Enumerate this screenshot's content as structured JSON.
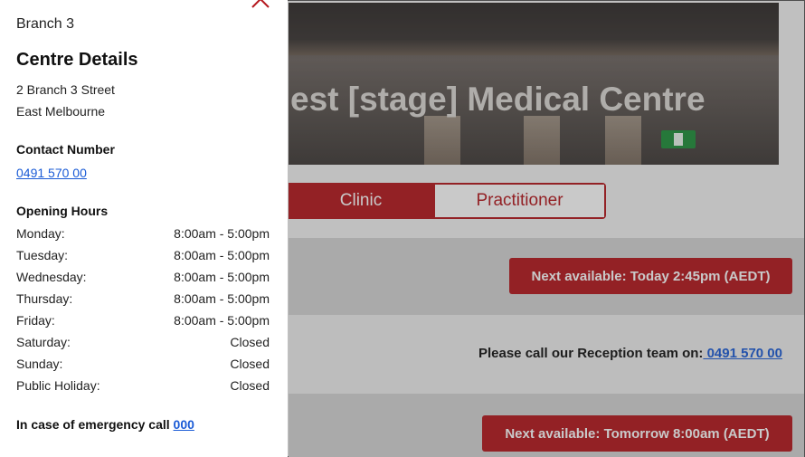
{
  "page": {
    "hero_title": "est [stage] Medical Centre",
    "tabs": [
      {
        "label": "Clinic",
        "active": true
      },
      {
        "label": "Practitioner",
        "active": false
      }
    ],
    "slots": {
      "first": "Next available: Today 2:45pm (AEDT)",
      "reception_text": "Please call our Reception team on:",
      "reception_phone": " 0491 570 00",
      "second": "Next available: Tomorrow 8:00am (AEDT)"
    },
    "accent_color": "#b5171d",
    "link_color": "#1a5bd6"
  },
  "panel": {
    "close_icon": "close-icon",
    "branch": "Branch 3",
    "title": "Centre Details",
    "address_line1": "2 Branch 3 Street",
    "address_line2": "East Melbourne",
    "contact_heading": "Contact Number",
    "contact_phone": "0491 570 00",
    "hours_heading": "Opening Hours",
    "hours": [
      {
        "day": "Monday:",
        "time": "8:00am - 5:00pm"
      },
      {
        "day": "Tuesday:",
        "time": "8:00am - 5:00pm"
      },
      {
        "day": "Wednesday:",
        "time": "8:00am - 5:00pm"
      },
      {
        "day": "Thursday:",
        "time": "8:00am - 5:00pm"
      },
      {
        "day": "Friday:",
        "time": "8:00am - 5:00pm"
      },
      {
        "day": "Saturday:",
        "time": "Closed"
      },
      {
        "day": "Sunday:",
        "time": "Closed"
      },
      {
        "day": "Public Holiday:",
        "time": "Closed"
      }
    ],
    "emergency_text": "In case of emergency call ",
    "emergency_number": "000"
  }
}
